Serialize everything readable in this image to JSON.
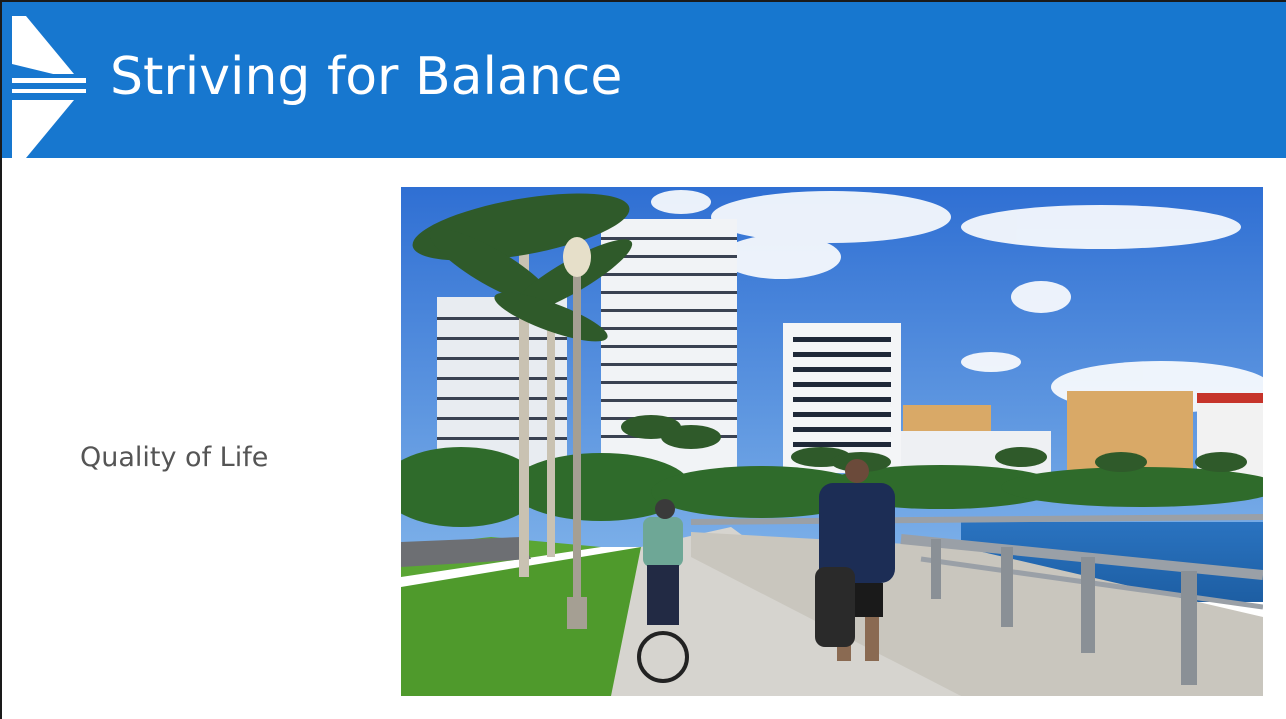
{
  "slide": {
    "title": "Striving for Balance",
    "side_label": "Quality of Life"
  },
  "colors": {
    "header": "#1777cf",
    "title_text": "#ffffff",
    "side_label_text": "#555555",
    "sky": "#3b78d6",
    "grass": "#4f9a2c",
    "water": "#2a73c0"
  },
  "icons": {
    "logo": "chevron-stripes-logo"
  },
  "photo": {
    "subject": "waterfront-promenade-photo"
  }
}
